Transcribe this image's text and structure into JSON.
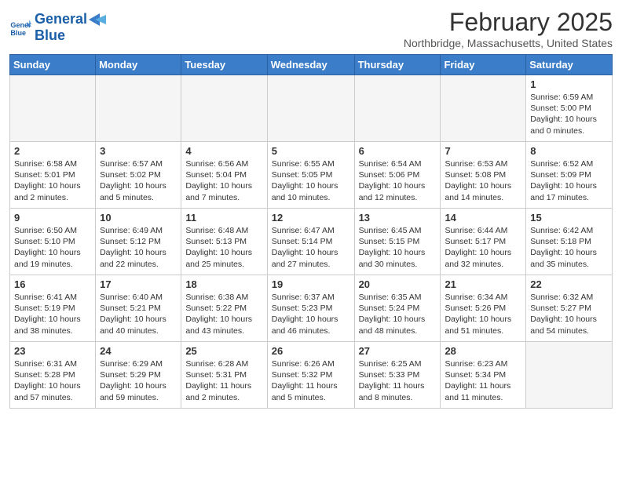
{
  "header": {
    "logo_line1": "General",
    "logo_line2": "Blue",
    "month": "February 2025",
    "location": "Northbridge, Massachusetts, United States"
  },
  "days_of_week": [
    "Sunday",
    "Monday",
    "Tuesday",
    "Wednesday",
    "Thursday",
    "Friday",
    "Saturday"
  ],
  "weeks": [
    [
      {
        "day": "",
        "info": ""
      },
      {
        "day": "",
        "info": ""
      },
      {
        "day": "",
        "info": ""
      },
      {
        "day": "",
        "info": ""
      },
      {
        "day": "",
        "info": ""
      },
      {
        "day": "",
        "info": ""
      },
      {
        "day": "1",
        "info": "Sunrise: 6:59 AM\nSunset: 5:00 PM\nDaylight: 10 hours\nand 0 minutes."
      }
    ],
    [
      {
        "day": "2",
        "info": "Sunrise: 6:58 AM\nSunset: 5:01 PM\nDaylight: 10 hours\nand 2 minutes."
      },
      {
        "day": "3",
        "info": "Sunrise: 6:57 AM\nSunset: 5:02 PM\nDaylight: 10 hours\nand 5 minutes."
      },
      {
        "day": "4",
        "info": "Sunrise: 6:56 AM\nSunset: 5:04 PM\nDaylight: 10 hours\nand 7 minutes."
      },
      {
        "day": "5",
        "info": "Sunrise: 6:55 AM\nSunset: 5:05 PM\nDaylight: 10 hours\nand 10 minutes."
      },
      {
        "day": "6",
        "info": "Sunrise: 6:54 AM\nSunset: 5:06 PM\nDaylight: 10 hours\nand 12 minutes."
      },
      {
        "day": "7",
        "info": "Sunrise: 6:53 AM\nSunset: 5:08 PM\nDaylight: 10 hours\nand 14 minutes."
      },
      {
        "day": "8",
        "info": "Sunrise: 6:52 AM\nSunset: 5:09 PM\nDaylight: 10 hours\nand 17 minutes."
      }
    ],
    [
      {
        "day": "9",
        "info": "Sunrise: 6:50 AM\nSunset: 5:10 PM\nDaylight: 10 hours\nand 19 minutes."
      },
      {
        "day": "10",
        "info": "Sunrise: 6:49 AM\nSunset: 5:12 PM\nDaylight: 10 hours\nand 22 minutes."
      },
      {
        "day": "11",
        "info": "Sunrise: 6:48 AM\nSunset: 5:13 PM\nDaylight: 10 hours\nand 25 minutes."
      },
      {
        "day": "12",
        "info": "Sunrise: 6:47 AM\nSunset: 5:14 PM\nDaylight: 10 hours\nand 27 minutes."
      },
      {
        "day": "13",
        "info": "Sunrise: 6:45 AM\nSunset: 5:15 PM\nDaylight: 10 hours\nand 30 minutes."
      },
      {
        "day": "14",
        "info": "Sunrise: 6:44 AM\nSunset: 5:17 PM\nDaylight: 10 hours\nand 32 minutes."
      },
      {
        "day": "15",
        "info": "Sunrise: 6:42 AM\nSunset: 5:18 PM\nDaylight: 10 hours\nand 35 minutes."
      }
    ],
    [
      {
        "day": "16",
        "info": "Sunrise: 6:41 AM\nSunset: 5:19 PM\nDaylight: 10 hours\nand 38 minutes."
      },
      {
        "day": "17",
        "info": "Sunrise: 6:40 AM\nSunset: 5:21 PM\nDaylight: 10 hours\nand 40 minutes."
      },
      {
        "day": "18",
        "info": "Sunrise: 6:38 AM\nSunset: 5:22 PM\nDaylight: 10 hours\nand 43 minutes."
      },
      {
        "day": "19",
        "info": "Sunrise: 6:37 AM\nSunset: 5:23 PM\nDaylight: 10 hours\nand 46 minutes."
      },
      {
        "day": "20",
        "info": "Sunrise: 6:35 AM\nSunset: 5:24 PM\nDaylight: 10 hours\nand 48 minutes."
      },
      {
        "day": "21",
        "info": "Sunrise: 6:34 AM\nSunset: 5:26 PM\nDaylight: 10 hours\nand 51 minutes."
      },
      {
        "day": "22",
        "info": "Sunrise: 6:32 AM\nSunset: 5:27 PM\nDaylight: 10 hours\nand 54 minutes."
      }
    ],
    [
      {
        "day": "23",
        "info": "Sunrise: 6:31 AM\nSunset: 5:28 PM\nDaylight: 10 hours\nand 57 minutes."
      },
      {
        "day": "24",
        "info": "Sunrise: 6:29 AM\nSunset: 5:29 PM\nDaylight: 10 hours\nand 59 minutes."
      },
      {
        "day": "25",
        "info": "Sunrise: 6:28 AM\nSunset: 5:31 PM\nDaylight: 11 hours\nand 2 minutes."
      },
      {
        "day": "26",
        "info": "Sunrise: 6:26 AM\nSunset: 5:32 PM\nDaylight: 11 hours\nand 5 minutes."
      },
      {
        "day": "27",
        "info": "Sunrise: 6:25 AM\nSunset: 5:33 PM\nDaylight: 11 hours\nand 8 minutes."
      },
      {
        "day": "28",
        "info": "Sunrise: 6:23 AM\nSunset: 5:34 PM\nDaylight: 11 hours\nand 11 minutes."
      },
      {
        "day": "",
        "info": ""
      }
    ]
  ]
}
